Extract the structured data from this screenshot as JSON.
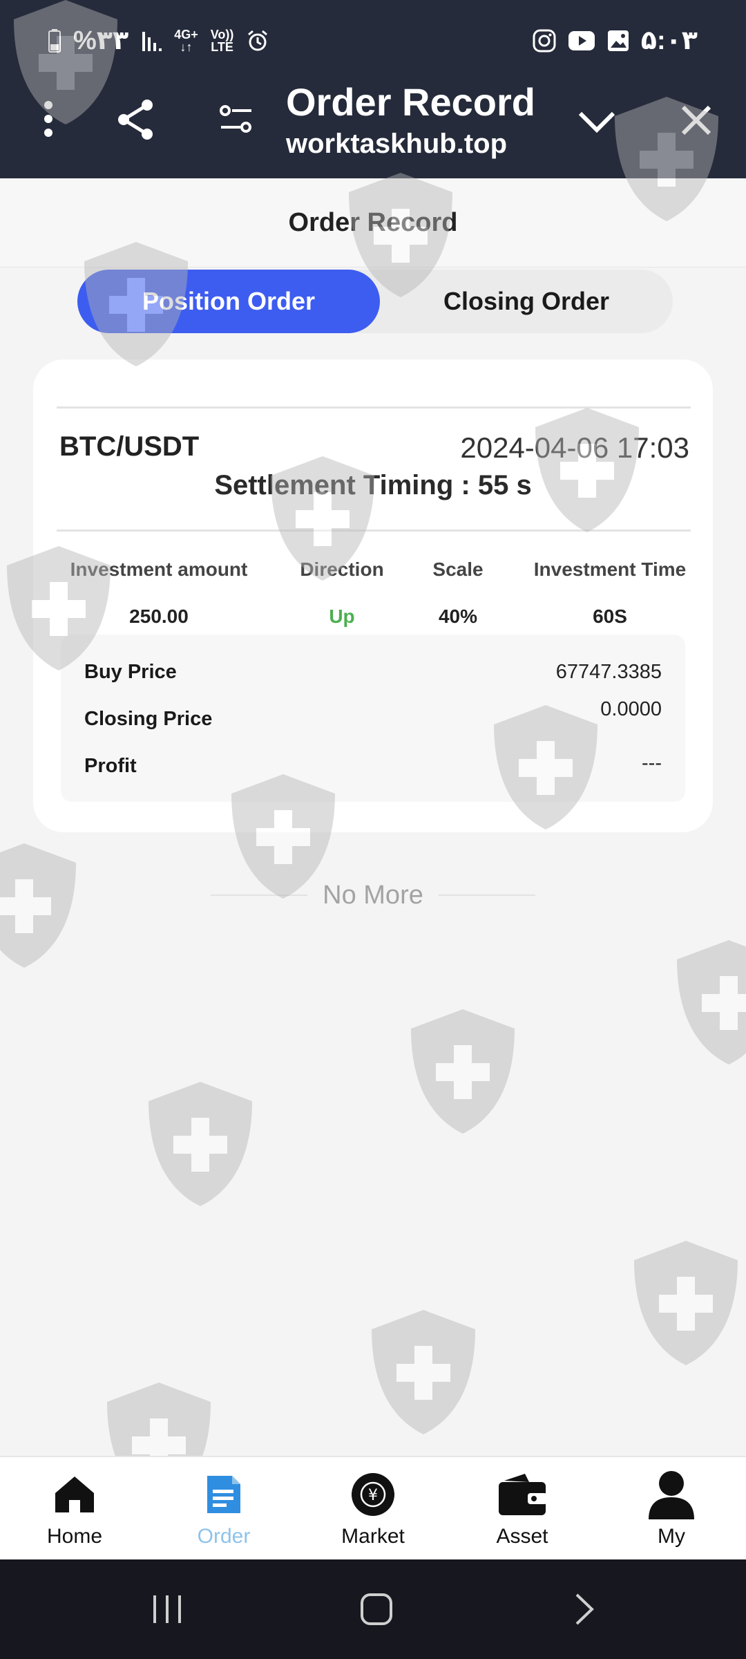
{
  "status_bar": {
    "battery_percent": "%۳۳",
    "network_top": "4G+",
    "volte_top": "Vo))",
    "volte_bottom": "LTE",
    "time": "۵:۰۳"
  },
  "browser": {
    "title": "Order Record",
    "url": "worktaskhub.top"
  },
  "page": {
    "header": "Order Record"
  },
  "tabs": [
    {
      "label": "Position Order",
      "active": true
    },
    {
      "label": "Closing Order",
      "active": false
    }
  ],
  "order": {
    "pair": "BTC/USDT",
    "datetime": "2024-04-06 17:03",
    "settlement": "Settlement Timing : 55 s",
    "columns": [
      "Investment amount",
      "Direction",
      "Scale",
      "Investment Time"
    ],
    "values": [
      "250.00",
      "Up",
      "40%",
      "60S"
    ],
    "details": [
      {
        "label": "Buy Price",
        "value": "67747.3385"
      },
      {
        "label": "Closing Price",
        "value": "0.0000"
      },
      {
        "label": "Profit",
        "value": "---"
      }
    ]
  },
  "list_end": "No More",
  "nav": [
    {
      "label": "Home",
      "icon": "home-icon"
    },
    {
      "label": "Order",
      "icon": "order-icon",
      "active": true
    },
    {
      "label": "Market",
      "icon": "market-icon"
    },
    {
      "label": "Asset",
      "icon": "wallet-icon"
    },
    {
      "label": "My",
      "icon": "user-icon"
    }
  ],
  "colors": {
    "accent": "#3d5df0",
    "up": "#4caf50",
    "topbar": "#262b3b",
    "nav_active": "#8ec3ea"
  }
}
